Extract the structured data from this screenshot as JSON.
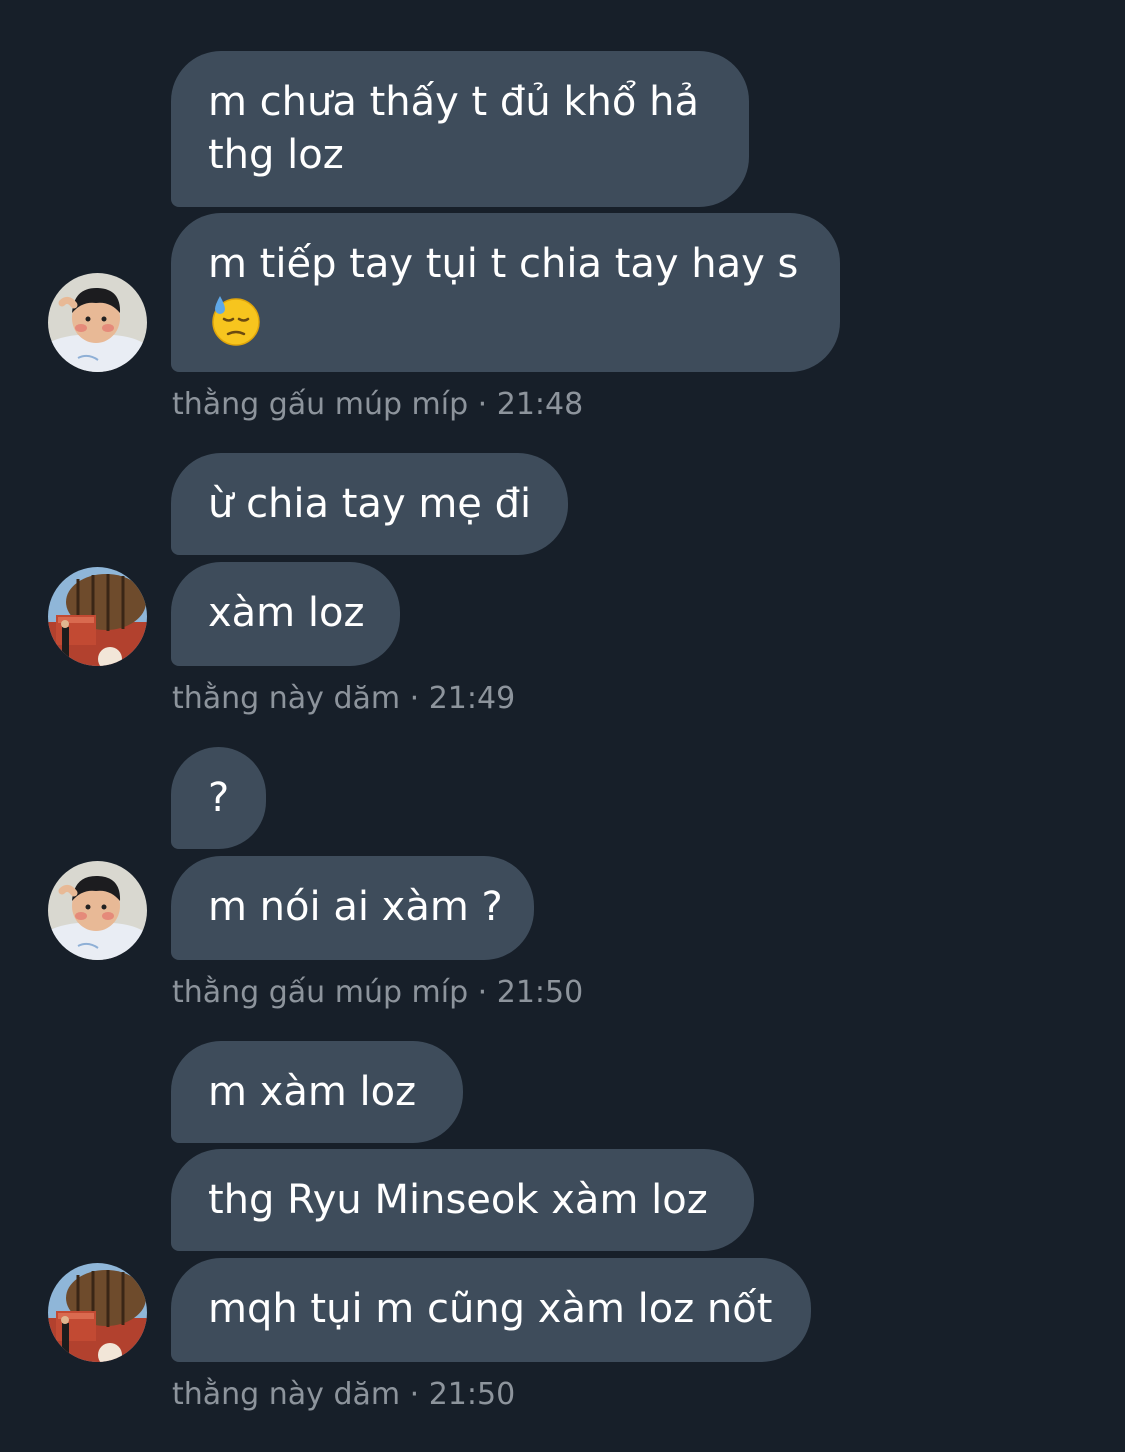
{
  "messages": [
    {
      "sender": "thằng gấu múp míp",
      "time": "21:48",
      "meta": "thằng gấu múp míp · 21:48",
      "avatar_icon": "child-photo-avatar",
      "bubbles": [
        {
          "line1": "m chưa thấy t đủ khổ hả",
          "line2": "thg loz"
        },
        {
          "line1": "m tiếp tay tụi t chia tay hay s",
          "emoji": "downcast-face-with-sweat-icon"
        }
      ]
    },
    {
      "sender": "thằng này dăm",
      "time": "21:49",
      "meta": "thằng này dăm · 21:49",
      "avatar_icon": "barrel-wagon-photo-avatar",
      "bubbles": [
        {
          "text": "ừ chia tay mẹ đi"
        },
        {
          "text": "xàm loz"
        }
      ]
    },
    {
      "sender": "thằng gấu múp míp",
      "time": "21:50",
      "meta": "thằng gấu múp míp · 21:50",
      "avatar_icon": "child-photo-avatar",
      "bubbles": [
        {
          "text": "?"
        },
        {
          "text": "m nói ai xàm ?"
        }
      ]
    },
    {
      "sender": "thằng này dăm",
      "time": "21:50",
      "meta": "thằng này dăm · 21:50",
      "avatar_icon": "barrel-wagon-photo-avatar",
      "bubbles": [
        {
          "text": "m xàm loz"
        },
        {
          "text": "thg Ryu Minseok xàm loz"
        },
        {
          "text": "mqh tụi m cũng xàm loz nốt"
        }
      ]
    }
  ],
  "colors": {
    "background": "#171f29",
    "bubble": "#3e4c5b",
    "bubble_text": "#ffffff",
    "meta_text": "#8d949c"
  }
}
